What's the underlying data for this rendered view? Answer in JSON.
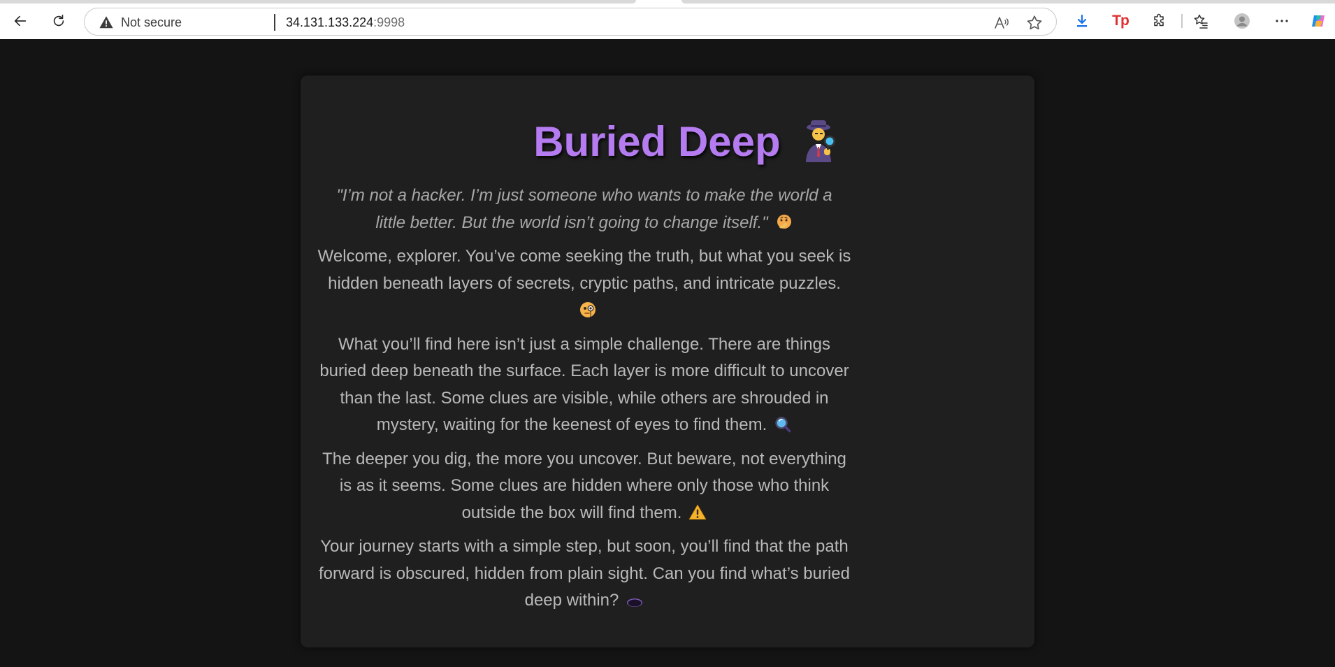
{
  "browser": {
    "security_label": "Not secure",
    "url_host": "34.131.133.224",
    "url_port": ":9998",
    "icons": [
      "back-arrow-icon",
      "reload-icon",
      "warning-triangle-icon",
      "read-aloud-icon",
      "favorite-star-icon",
      "download-icon",
      "tp-extension-icon",
      "extensions-puzzle-icon",
      "favorites-list-icon",
      "profile-avatar-icon",
      "more-menu-icon",
      "copilot-icon"
    ]
  },
  "page": {
    "title": "Buried Deep",
    "title_emoji": "detective-emoji",
    "quote": "\"I’m not a hacker. I’m just someone who wants to make the world a little better. But the world isn’t going to change itself.\"",
    "paragraphs": [
      "Welcome, explorer. You’ve come seeking the truth, but what you seek is hidden beneath layers of secrets, cryptic paths, and intricate puzzles.",
      "What you’ll find here isn’t just a simple challenge. There are things buried deep beneath the surface. Each layer is more difficult to uncover than the last. Some clues are visible, while others are shrouded in mystery, waiting for the keenest of eyes to find them.",
      "The deeper you dig, the more you uncover. But beware, not everything is as it seems. Some clues are hidden where only those who think outside the box will find them.",
      "Your journey starts with a simple step, but soon, you’ll find that the path forward is obscured, hidden from plain sight. Can you find what’s buried deep within?"
    ],
    "emojis": [
      "thinking-face-emoji",
      "face-with-monocle-emoji",
      "magnifying-glass-emoji",
      "warning-emoji",
      "hole-emoji"
    ]
  },
  "colors": {
    "title": "#b57bf0",
    "page_background": "#141414",
    "card_background": "#1f1f1f",
    "body_text": "#b9b9b9"
  }
}
